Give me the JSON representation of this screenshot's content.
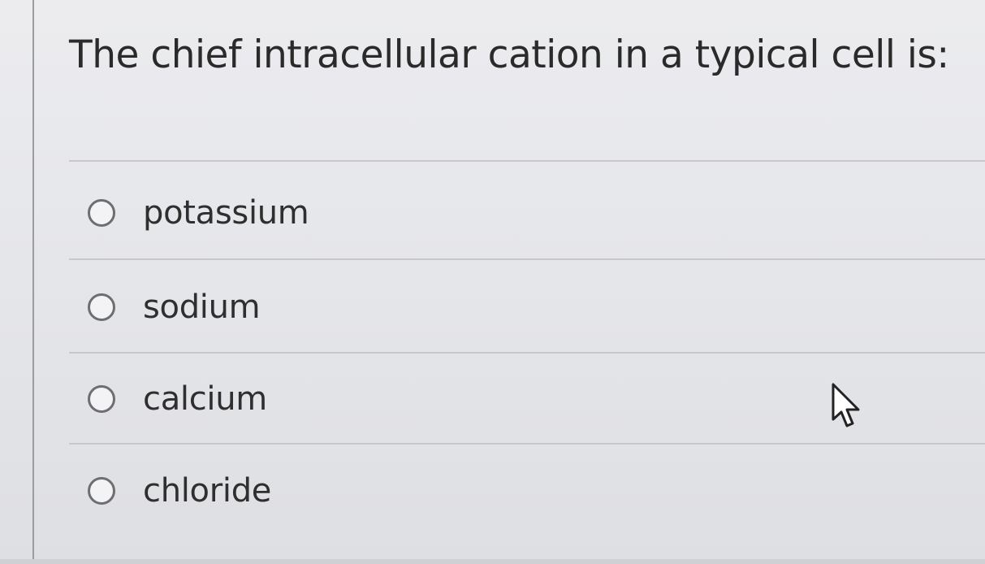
{
  "question": {
    "text": "The chief intracellular cation in a typical cell is:"
  },
  "options": [
    {
      "label": "potassium",
      "selected": false
    },
    {
      "label": "sodium",
      "selected": false
    },
    {
      "label": "calcium",
      "selected": false
    },
    {
      "label": "chloride",
      "selected": false
    }
  ],
  "icons": {
    "radio": "radio-button-icon",
    "cursor": "mouse-pointer-icon"
  },
  "colors": {
    "background": "#e6e7ea",
    "text": "#2b2b2b",
    "radio_border": "#6c6e72",
    "divider": "#c6c8cc"
  }
}
